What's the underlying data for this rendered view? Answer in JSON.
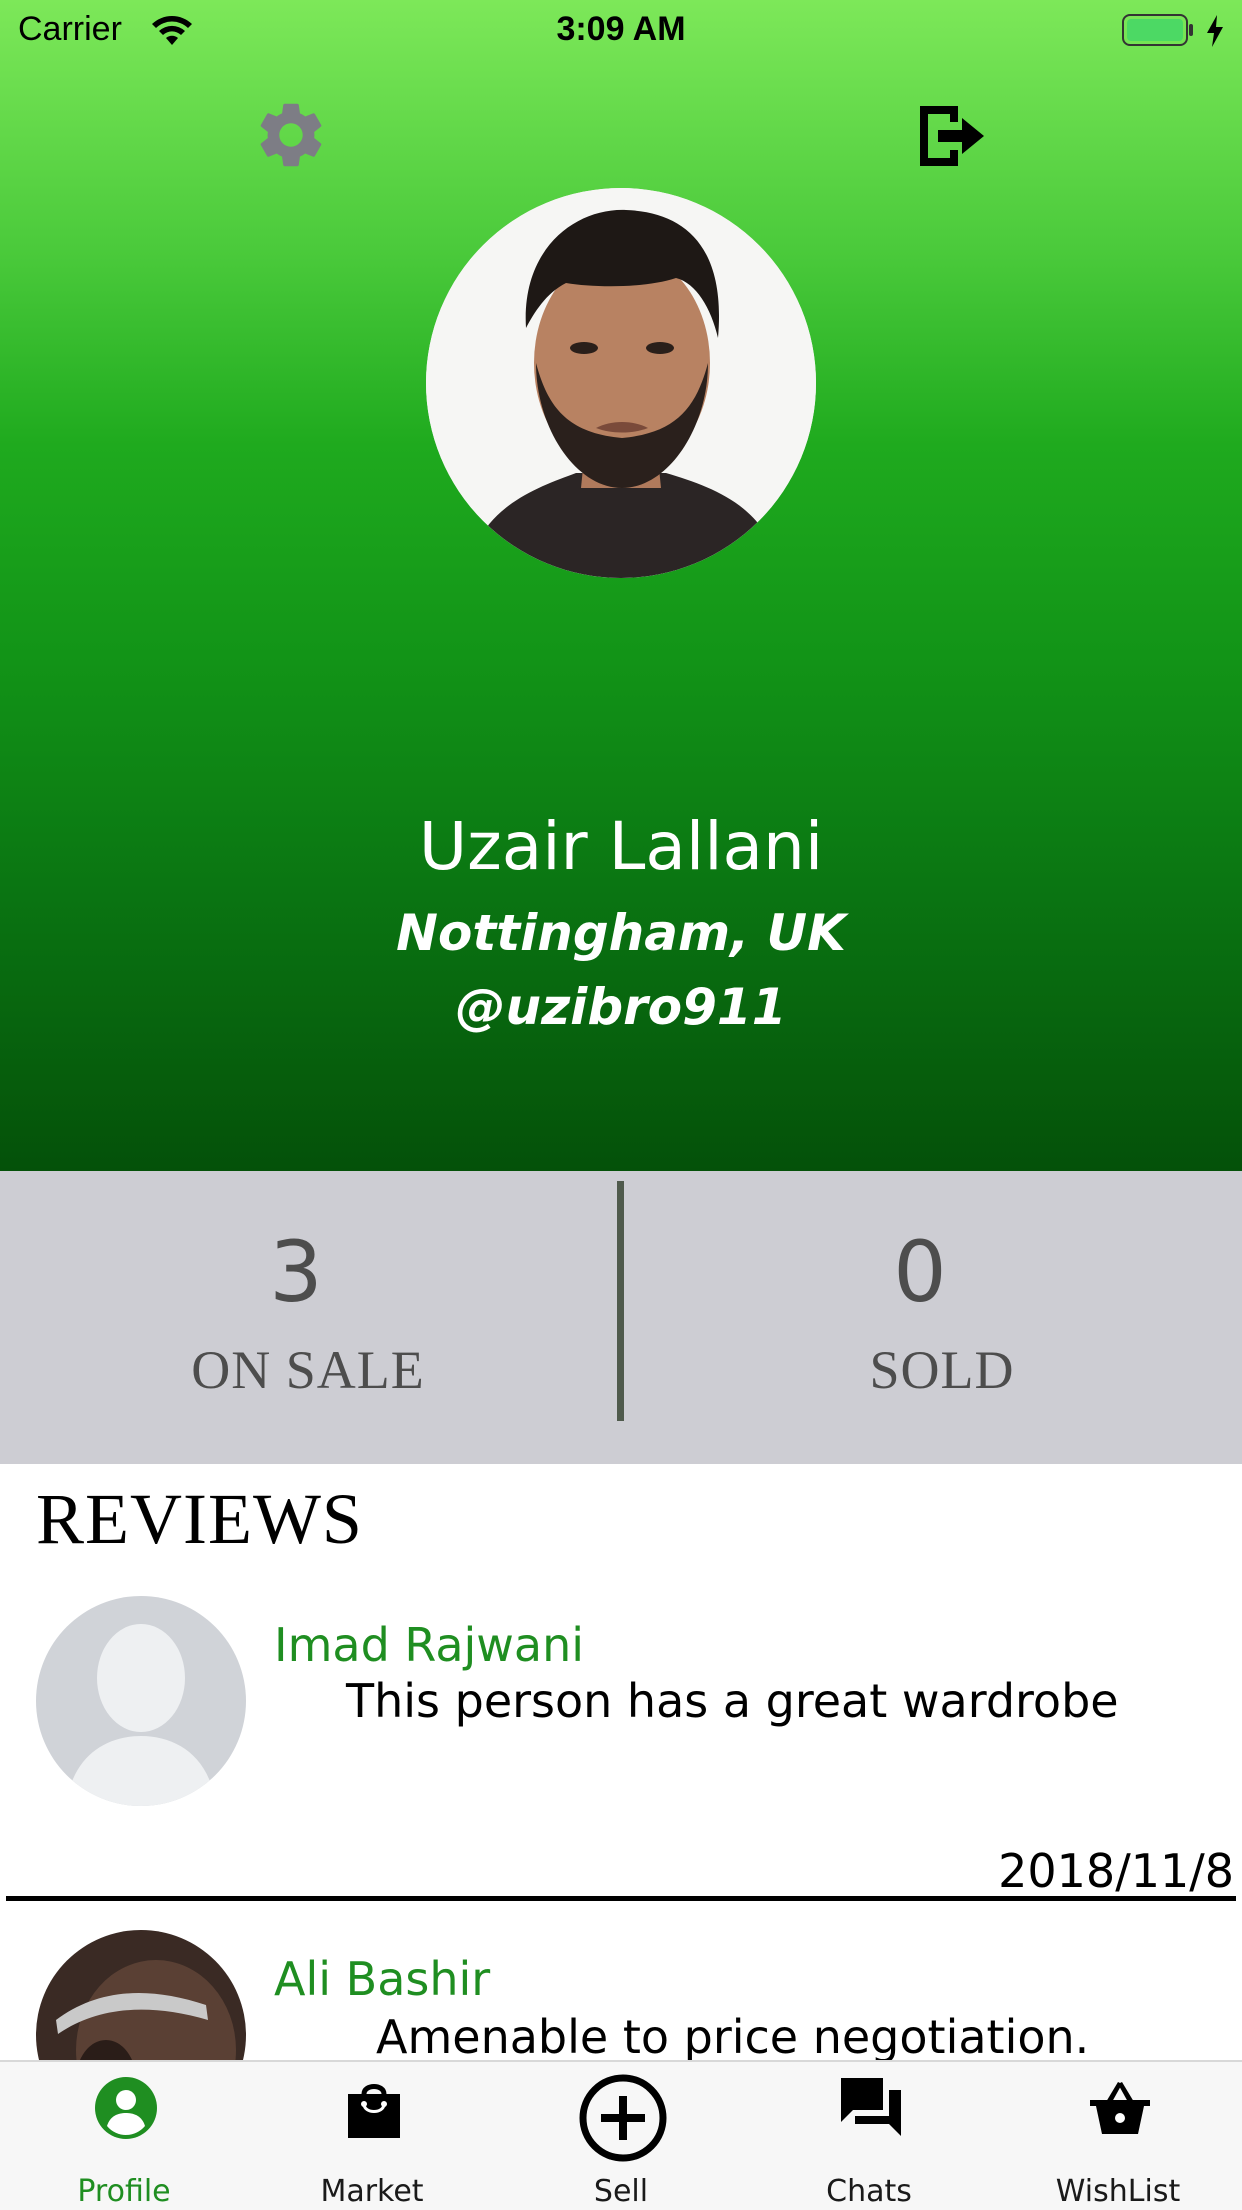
{
  "status_bar": {
    "carrier": "Carrier",
    "time": "3:09 AM"
  },
  "header": {
    "settings_icon": "gear-icon",
    "logout_icon": "logout-icon"
  },
  "profile": {
    "name": "Uzair Lallani",
    "location": "Nottingham, UK",
    "handle": "@uzibro911"
  },
  "stats": {
    "on_sale_count": "3",
    "on_sale_label": "ON SALE",
    "sold_count": "0",
    "sold_label": "SOLD"
  },
  "reviews": {
    "title": "REVIEWS",
    "items": [
      {
        "name": "Imad Rajwani",
        "text": "This person has a great wardrobe",
        "date": "2018/11/8"
      },
      {
        "name": "Ali Bashir",
        "text": "Amenable to price negotiation."
      }
    ]
  },
  "tabbar": {
    "tabs": [
      {
        "label": "Profile",
        "icon": "profile-icon",
        "active": true
      },
      {
        "label": "Market",
        "icon": "shopping-bag-icon"
      },
      {
        "label": "Sell",
        "icon": "plus-circle-icon"
      },
      {
        "label": "Chats",
        "icon": "chat-icon"
      },
      {
        "label": "WishList",
        "icon": "basket-icon"
      }
    ]
  },
  "colors": {
    "accent": "#1f8e21",
    "header_top": "#7de859",
    "header_bottom": "#045109",
    "stats_bg": "#cdcdd3"
  }
}
